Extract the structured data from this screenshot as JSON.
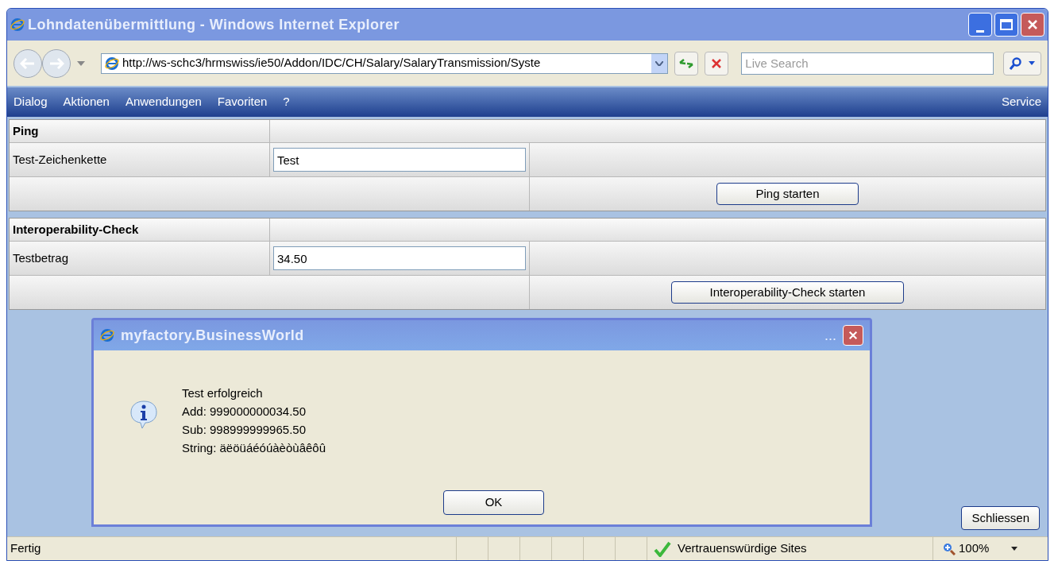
{
  "window": {
    "title": "Lohndatenübermittlung - Windows Internet Explorer"
  },
  "address_bar": {
    "value": "http://ws-schc3/hrmswiss/ie50/Addon/IDC/CH/Salary/SalaryTransmission/Syste"
  },
  "search": {
    "placeholder": "Live Search"
  },
  "menu": [
    {
      "label": "Dialog"
    },
    {
      "label": "Aktionen"
    },
    {
      "label": "Anwendungen"
    },
    {
      "label": "Favoriten"
    },
    {
      "label": "?"
    }
  ],
  "menu_right": "Service",
  "sections": [
    {
      "title": "Ping",
      "field": {
        "label": "Test-Zeichenkette",
        "value": "Test"
      },
      "button": "Ping starten"
    },
    {
      "title": "Interoperability-Check",
      "field": {
        "label": "Testbetrag",
        "value": "34.50"
      },
      "button": "Interoperability-Check starten"
    }
  ],
  "close_button": "Schliessen",
  "dialog": {
    "title": "myfactory.BusinessWorld",
    "title_extra": "...",
    "lines": [
      "Test erfolgreich",
      "Add: 999000000034.50",
      "Sub: 998999999965.50",
      "String: äëöüáéóúàèòùâêôû"
    ],
    "button": "OK"
  },
  "status_bar": {
    "text": "Fertig",
    "zone": "Vertrauenswürdige Sites",
    "zoom": "100%"
  }
}
